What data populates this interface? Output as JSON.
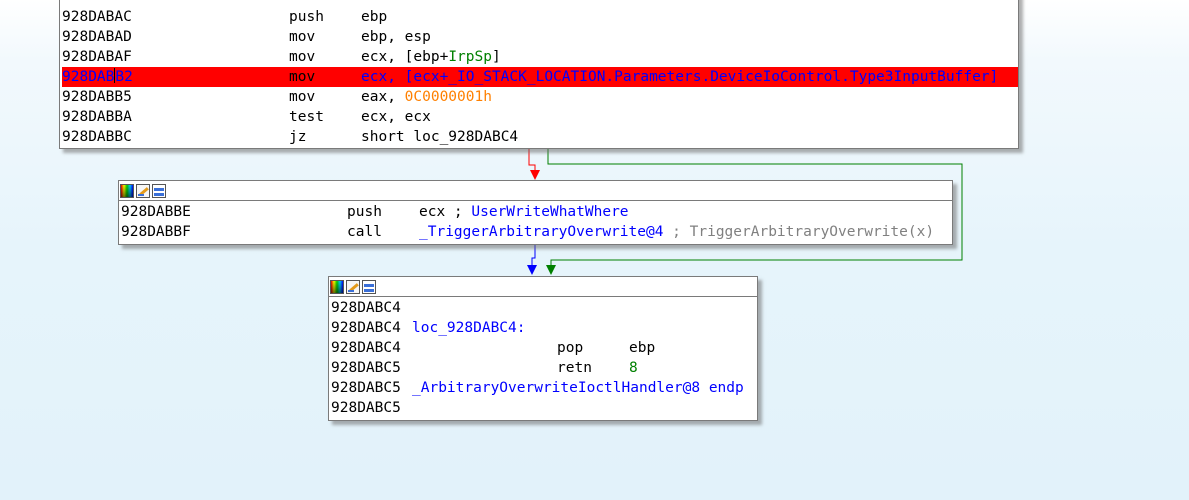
{
  "colors": {
    "highlight": "#ff0000",
    "edge_false": "#ff0000",
    "edge_true": "#008000",
    "edge_flow": "#0000ff",
    "operand_name": "#0000ff",
    "operand_struct": "#008000",
    "constant": "#ff8000",
    "comment": "#808080"
  },
  "header_icons": [
    "palette-icon",
    "rename-icon",
    "graph-icon"
  ],
  "node1": {
    "lines": [
      {
        "addr": "928DABAC",
        "mnem": "push",
        "op": "ebp"
      },
      {
        "addr": "928DABAD",
        "mnem": "mov",
        "op": "ebp, esp"
      },
      {
        "addr": "928DABAF",
        "mnem": "mov",
        "op_pre": "ecx, [ebp+",
        "op_struct": "IrpSp",
        "op_post": "]"
      },
      {
        "addr_a": "928DAB",
        "addr_b": "B2",
        "mnem": "mov",
        "op": "ecx, [ecx+_IO_STACK_LOCATION.Parameters.DeviceIoControl.Type3InputBuffer]"
      },
      {
        "addr": "928DABB5",
        "mnem": "mov",
        "op_pre": "eax, ",
        "op_const": "0C0000001h"
      },
      {
        "addr": "928DABBA",
        "mnem": "test",
        "op": "ecx, ecx"
      },
      {
        "addr": "928DABBC",
        "mnem": "jz",
        "op_pre": "short ",
        "op_target": "loc_928DABC4"
      }
    ]
  },
  "node2": {
    "lines": [
      {
        "addr": "928DABBE",
        "mnem": "push",
        "op_pre": "ecx ; ",
        "op_name": "UserWriteWhatWhere"
      },
      {
        "addr": "928DABBF",
        "mnem": "call",
        "op_name": "_TriggerArbitraryOverwrite@4",
        "comment": " ; TriggerArbitraryOverwrite(x)"
      }
    ]
  },
  "node3": {
    "lines": [
      {
        "addr": "928DABC4"
      },
      {
        "addr": "928DABC4",
        "label": "loc_928DABC4:"
      },
      {
        "addr": "928DABC4",
        "mnem": "pop",
        "op": "ebp"
      },
      {
        "addr": "928DABC5",
        "mnem": "retn",
        "op_num": "8"
      },
      {
        "addr": "928DABC5",
        "proc_end": "_ArbitraryOverwriteIoctlHandler@8",
        "endp": "endp"
      },
      {
        "addr": "928DABC5"
      }
    ]
  }
}
